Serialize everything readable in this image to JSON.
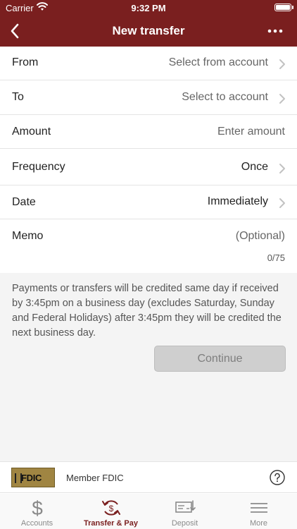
{
  "status_bar": {
    "carrier": "Carrier",
    "time": "9:32 PM"
  },
  "navbar": {
    "title": "New transfer",
    "back_icon": "chevron-left-icon",
    "more_icon": "ellipsis-icon"
  },
  "form": {
    "from": {
      "label": "From",
      "value": "Select from account"
    },
    "to": {
      "label": "To",
      "value": "Select to account"
    },
    "amount": {
      "label": "Amount",
      "placeholder": "Enter amount"
    },
    "frequency": {
      "label": "Frequency",
      "value": "Once"
    },
    "date": {
      "label": "Date",
      "value": "Immediately"
    },
    "memo": {
      "label": "Memo",
      "placeholder": "(Optional)",
      "counter": "0/75"
    }
  },
  "disclaimer": "Payments or transfers will be credited same day if received by 3:45pm on a business day (excludes Saturday, Sunday and Federal Holidays) after 3:45pm they will be credited the next business day.",
  "continue_label": "Continue",
  "fdic": {
    "logo_text": "FDIC",
    "member_text": "Member FDIC"
  },
  "tabs": [
    {
      "label": "Accounts",
      "icon": "dollar-icon"
    },
    {
      "label": "Transfer & Pay",
      "icon": "transfer-icon",
      "active": true
    },
    {
      "label": "Deposit",
      "icon": "check-deposit-icon"
    },
    {
      "label": "More",
      "icon": "menu-icon"
    }
  ],
  "colors": {
    "brand": "#7a1f1f",
    "muted_text": "#666666",
    "button_disabled": "#cfcfcf"
  }
}
